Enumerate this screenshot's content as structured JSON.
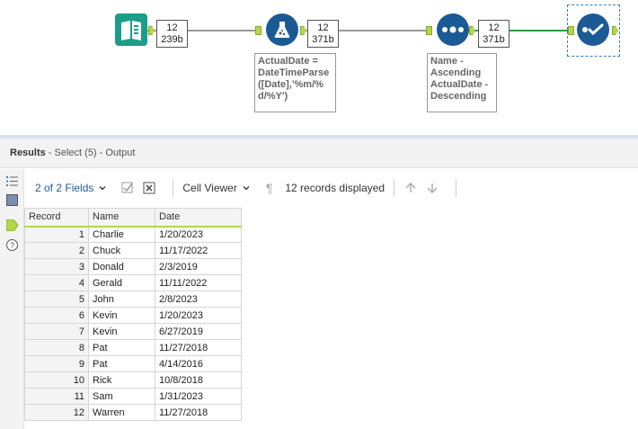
{
  "workflow": {
    "input_badge": {
      "records": "12",
      "size": "239b"
    },
    "formula_badge": {
      "records": "12",
      "size": "371b"
    },
    "sort_badge": {
      "records": "12",
      "size": "371b"
    },
    "formula_annotation": "ActualDate =\nDateTimeParse\n([Date],'%m/%\nd/%Y')",
    "sort_annotation": "Name -\nAscending\nActualDate -\nDescending",
    "colors": {
      "input": "#1a9e8a",
      "tool_blue": "#1c5a96",
      "anchor": "#b3d64a",
      "wire_green": "#2e9a48",
      "wire_gray": "#9a9a9a"
    }
  },
  "results": {
    "title": "Results",
    "subtitle": " - Select (5) - Output"
  },
  "toolbar": {
    "fields_label": "2 of 2 Fields",
    "viewer_label": "Cell Viewer",
    "records_label": "12 records displayed"
  },
  "table": {
    "columns": [
      "Record",
      "Name",
      "Date"
    ],
    "rows": [
      [
        "1",
        "Charlie",
        "1/20/2023"
      ],
      [
        "2",
        "Chuck",
        "11/17/2022"
      ],
      [
        "3",
        "Donald",
        "2/3/2019"
      ],
      [
        "4",
        "Gerald",
        "11/11/2022"
      ],
      [
        "5",
        "John",
        "2/8/2023"
      ],
      [
        "6",
        "Kevin",
        "1/20/2023"
      ],
      [
        "7",
        "Kevin",
        "6/27/2019"
      ],
      [
        "8",
        "Pat",
        "11/27/2018"
      ],
      [
        "9",
        "Pat",
        "4/14/2016"
      ],
      [
        "10",
        "Rick",
        "10/8/2018"
      ],
      [
        "11",
        "Sam",
        "1/31/2023"
      ],
      [
        "12",
        "Warren",
        "11/27/2018"
      ]
    ]
  }
}
